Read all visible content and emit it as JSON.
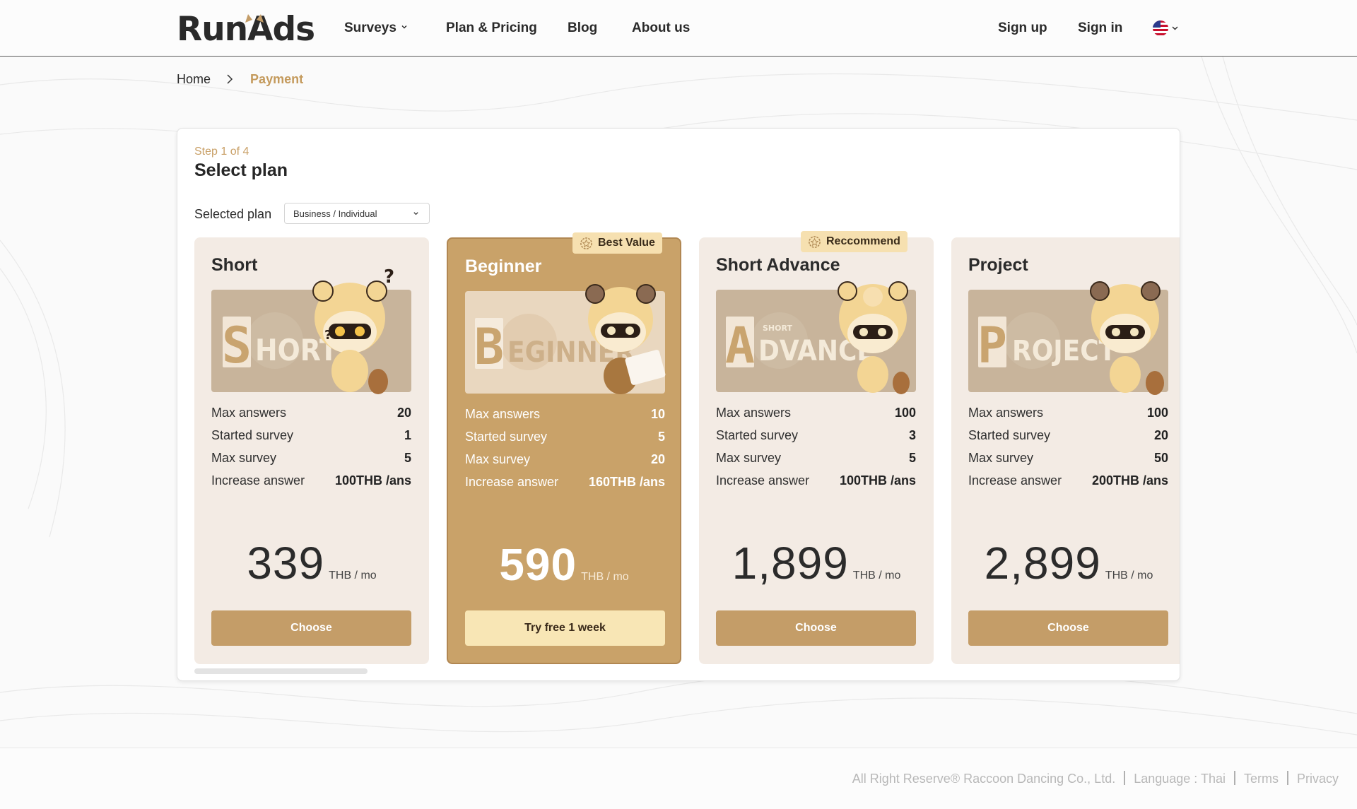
{
  "header": {
    "logo": "RunAds",
    "nav": [
      {
        "label": "Surveys"
      },
      {
        "label": "Plan & Pricing"
      },
      {
        "label": "Blog"
      },
      {
        "label": "About us"
      }
    ],
    "sign_up": "Sign up",
    "sign_in": "Sign in",
    "language_icon": "us-flag-icon"
  },
  "breadcrumb": {
    "home": "Home",
    "current": "Payment"
  },
  "panel": {
    "step": "Step 1 of 4",
    "title": "Select plan",
    "selected_plan_label": "Selected plan",
    "selected_plan_value": "Business / Individual"
  },
  "stat_labels": [
    "Max answers",
    "Started survey",
    "Max survey",
    "Increase answer"
  ],
  "plans": [
    {
      "name": "Short",
      "banner_letter": "S",
      "banner_rest": "HORT",
      "banner_small": "",
      "badge": "",
      "stats": [
        "20",
        "1",
        "5",
        "100THB /ans"
      ],
      "price": "339",
      "unit": "THB / mo",
      "button": "Choose"
    },
    {
      "name": "Beginner",
      "banner_letter": "B",
      "banner_rest": "EGINNER",
      "banner_small": "",
      "badge": "Best Value",
      "stats": [
        "10",
        "5",
        "20",
        "160THB /ans"
      ],
      "price": "590",
      "unit": "THB / mo",
      "button": "Try free 1 week"
    },
    {
      "name": "Short Advance",
      "banner_letter": "A",
      "banner_rest": "DVANCE",
      "banner_small": "SHORT",
      "badge": "Reccommend",
      "stats": [
        "100",
        "3",
        "5",
        "100THB /ans"
      ],
      "price": "1,899",
      "unit": "THB / mo",
      "button": "Choose"
    },
    {
      "name": "Project",
      "banner_letter": "P",
      "banner_rest": "ROJECT",
      "banner_small": "",
      "badge": "",
      "stats": [
        "100",
        "20",
        "50",
        "200THB /ans"
      ],
      "price": "2,899",
      "unit": "THB / mo",
      "button": "Choose"
    }
  ],
  "footer": {
    "copyright": "All Right Reserve® Raccoon Dancing Co., Ltd.",
    "language": "Language : Thai",
    "terms": "Terms",
    "privacy": "Privacy"
  },
  "colors": {
    "accent": "#c49d68",
    "featured_card": "#c9a269",
    "card_bg": "#f3ebe4",
    "badge_bg": "#f6e0b0",
    "step_text": "#c9a067"
  }
}
